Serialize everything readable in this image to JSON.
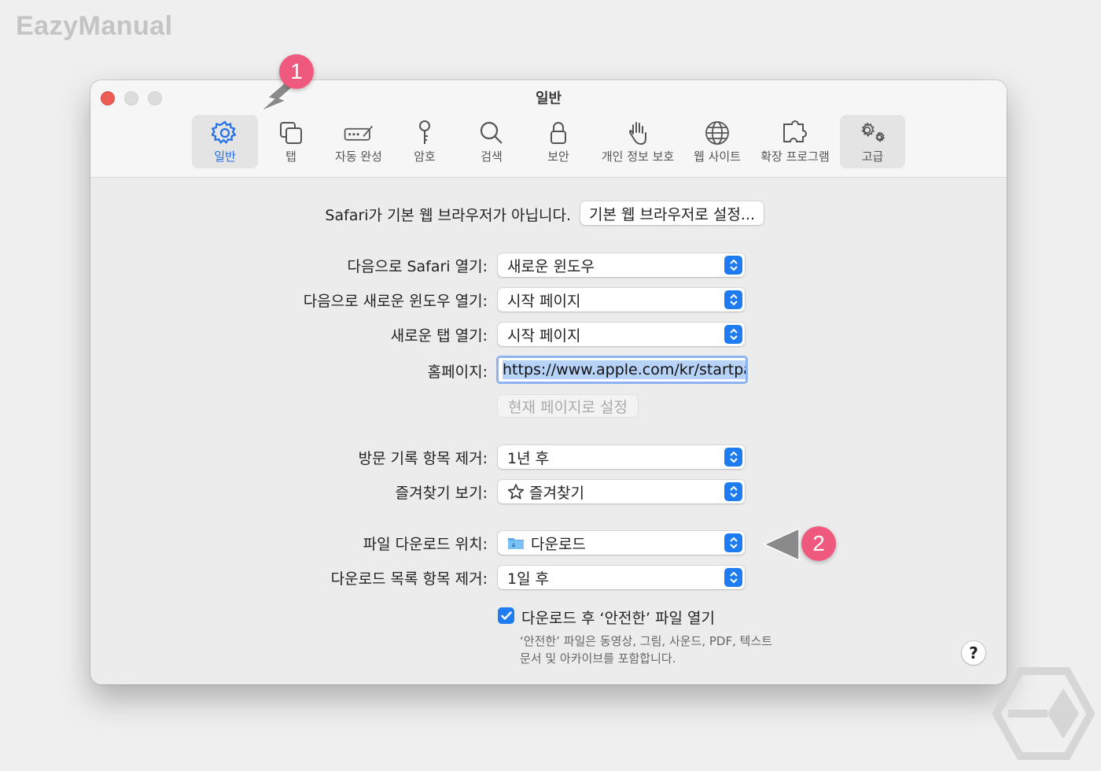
{
  "brand": "EazyManual",
  "window": {
    "title": "일반"
  },
  "toolbar": [
    {
      "label": "일반",
      "icon": "gear-icon",
      "selected": true
    },
    {
      "label": "탭",
      "icon": "tabs-icon"
    },
    {
      "label": "자동 완성",
      "icon": "autofill-icon"
    },
    {
      "label": "암호",
      "icon": "key-icon"
    },
    {
      "label": "검색",
      "icon": "search-icon"
    },
    {
      "label": "보안",
      "icon": "lock-icon"
    },
    {
      "label": "개인 정보 보호",
      "icon": "hand-icon"
    },
    {
      "label": "웹 사이트",
      "icon": "globe-icon"
    },
    {
      "label": "확장 프로그램",
      "icon": "puzzle-icon"
    },
    {
      "label": "고급",
      "icon": "gears-icon"
    }
  ],
  "default_browser": {
    "message": "Safari가 기본 웹 브라우저가 아닙니다.",
    "button": "기본 웹 브라우저로 설정..."
  },
  "settings": {
    "open_with": {
      "label": "다음으로 Safari 열기:",
      "value": "새로운 윈도우"
    },
    "new_window": {
      "label": "다음으로 새로운 윈도우 열기:",
      "value": "시작 페이지"
    },
    "new_tab": {
      "label": "새로운 탭 열기:",
      "value": "시작 페이지"
    },
    "homepage": {
      "label": "홈페이지:",
      "value": "https://www.apple.com/kr/startpage/",
      "button": "현재 페이지로 설정"
    },
    "remove_history": {
      "label": "방문 기록 항목 제거:",
      "value": "1년 후"
    },
    "favorites": {
      "label": "즐겨찾기 보기:",
      "value": "즐겨찾기"
    },
    "download_location": {
      "label": "파일 다운로드 위치:",
      "value": "다운로드"
    },
    "remove_downloads": {
      "label": "다운로드 목록 항목 제거:",
      "value": "1일 후"
    },
    "open_safe": {
      "label": "다운로드 후 ‘안전한’ 파일 열기",
      "checked": true,
      "hint_line1": "‘안전한’ 파일은 동영상, 그림, 사운드, PDF, 텍스트",
      "hint_line2": "문서 및 아카이브를 포함합니다."
    }
  },
  "help": "?",
  "annotations": {
    "badge1": "1",
    "badge2": "2"
  },
  "colors": {
    "accent": "#1e7cf0",
    "badge": "#f0597e",
    "close": "#ee5d56"
  }
}
